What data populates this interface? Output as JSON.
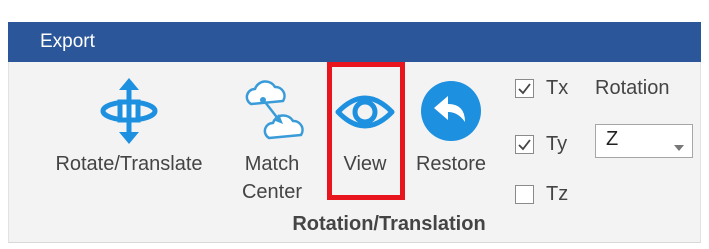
{
  "tab": {
    "title": "Export"
  },
  "buttons": {
    "rotate": "Rotate/Translate",
    "match_line1": "Match",
    "match_line2": "Center",
    "view": "View",
    "restore": "Restore"
  },
  "checkboxes": [
    {
      "label": "Tx",
      "checked": true
    },
    {
      "label": "Ty",
      "checked": true
    },
    {
      "label": "Tz",
      "checked": false
    }
  ],
  "rotation": {
    "label": "Rotation",
    "value": "Z"
  },
  "group": {
    "label": "Rotation/Translation"
  },
  "icons": {
    "rotate": "rotate-translate-icon",
    "match": "cloud-match-icon",
    "view": "eye-icon",
    "restore": "undo-circle-icon",
    "dropdown": "chevron-down-icon",
    "check": "checkmark-icon"
  },
  "colors": {
    "tab_bar": "#2b579a",
    "icon_blue": "#1e90e0",
    "highlight": "#e8141e"
  }
}
